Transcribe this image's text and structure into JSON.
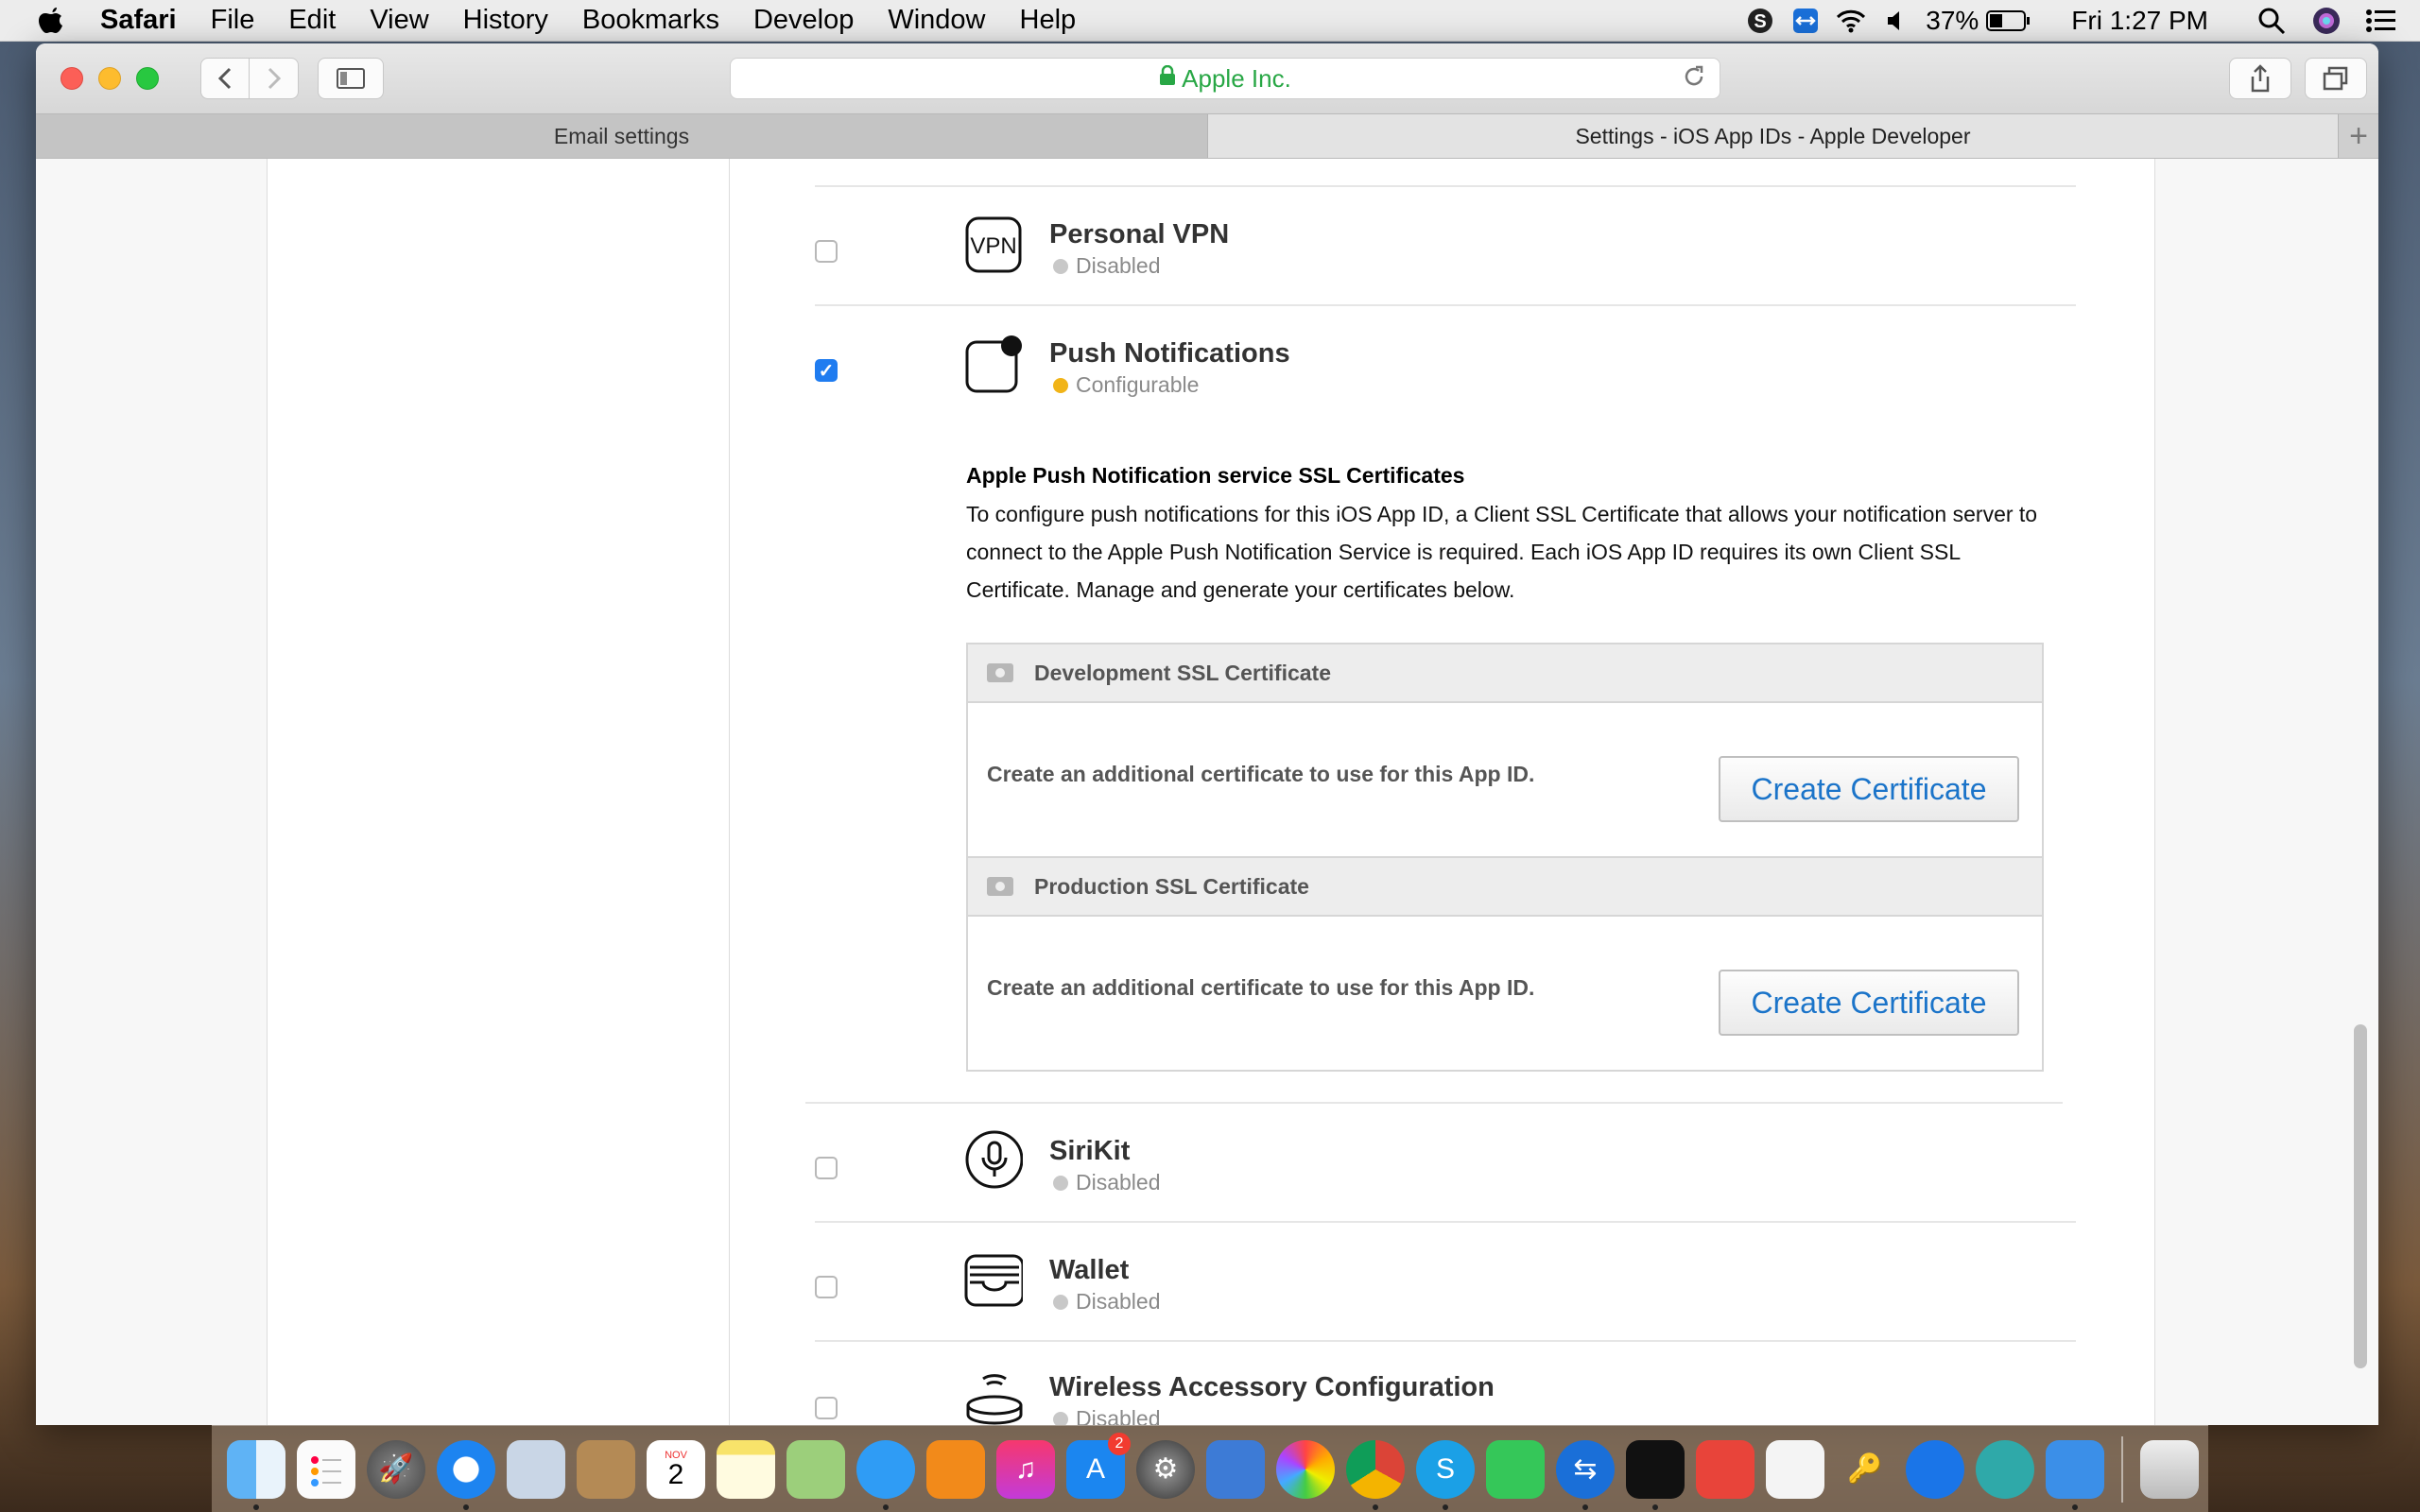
{
  "menubar": {
    "app_name": "Safari",
    "menus": [
      "File",
      "Edit",
      "View",
      "History",
      "Bookmarks",
      "Develop",
      "Window",
      "Help"
    ],
    "battery": "37%",
    "clock": "Fri 1:27 PM"
  },
  "browser": {
    "address": "Apple Inc.",
    "tabs": [
      "Email settings",
      "Settings - iOS App IDs - Apple Developer"
    ],
    "add_tab": "+"
  },
  "services": {
    "vpn": {
      "icon_text": "VPN",
      "name": "Personal VPN",
      "status": "Disabled",
      "checked": false
    },
    "push": {
      "name": "Push Notifications",
      "status": "Configurable",
      "checked": true
    },
    "sirikit": {
      "name": "SiriKit",
      "status": "Disabled",
      "checked": false
    },
    "wallet": {
      "name": "Wallet",
      "status": "Disabled",
      "checked": false
    },
    "wireless": {
      "name": "Wireless Accessory Configuration",
      "status": "Disabled",
      "checked": false
    }
  },
  "apns": {
    "title": "Apple Push Notification service SSL Certificates",
    "description": "To configure push notifications for this iOS App ID, a Client SSL Certificate that allows your notification server to connect to the Apple Push Notification Service is required. Each iOS App ID requires its own Client SSL Certificate. Manage and generate your certificates below.",
    "development": {
      "header": "Development SSL Certificate",
      "text": "Create an additional certificate to use for this App ID.",
      "button": "Create Certificate"
    },
    "production": {
      "header": "Production SSL Certificate",
      "text": "Create an additional certificate to use for this App ID.",
      "button": "Create Certificate"
    }
  },
  "dock": {
    "calendar_month": "NOV",
    "calendar_day": "2",
    "appstore_badge": "2"
  },
  "colors": {
    "accent": "#1b74c9",
    "checked": "#1f7cf0",
    "configurable": "#f1b418",
    "disabled": "#c8c8c8",
    "secure": "#28a745"
  }
}
